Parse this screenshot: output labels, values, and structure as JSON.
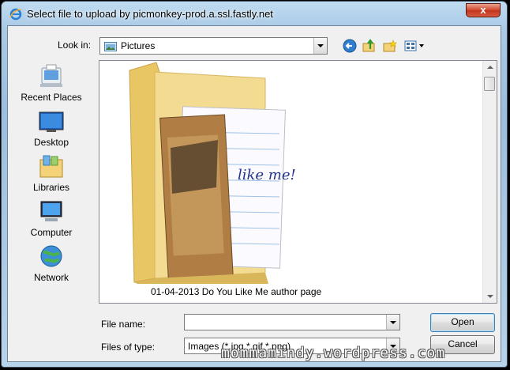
{
  "window": {
    "title": "Select file to upload by picmonkey-prod.a.ssl.fastly.net",
    "close_glyph": "x"
  },
  "toolbar": {
    "look_in_label": "Look in:",
    "look_in_value": "Pictures",
    "icons": [
      "back-icon",
      "up-folder-icon",
      "new-folder-icon",
      "view-menu-icon"
    ]
  },
  "places": [
    {
      "label": "Recent Places",
      "icon": "recent-places-icon"
    },
    {
      "label": "Desktop",
      "icon": "desktop-icon"
    },
    {
      "label": "Libraries",
      "icon": "libraries-icon"
    },
    {
      "label": "Computer",
      "icon": "computer-icon"
    },
    {
      "label": "Network",
      "icon": "network-icon"
    }
  ],
  "files": [
    {
      "name": "01-04-2013 Do You Like Me author page",
      "type": "folder",
      "thumb_text": "like me!"
    }
  ],
  "form": {
    "file_name_label": "File name:",
    "file_name_value": "",
    "file_type_label": "Files of type:",
    "file_type_value": "Images (*.jpg,*.gif,*.png)"
  },
  "buttons": {
    "open": "Open",
    "cancel": "Cancel"
  },
  "watermark": "mommamindy.wordpress.com",
  "colors": {
    "accent": "#3c7fb1",
    "close": "#c13420",
    "folder": "#f1d88a"
  }
}
